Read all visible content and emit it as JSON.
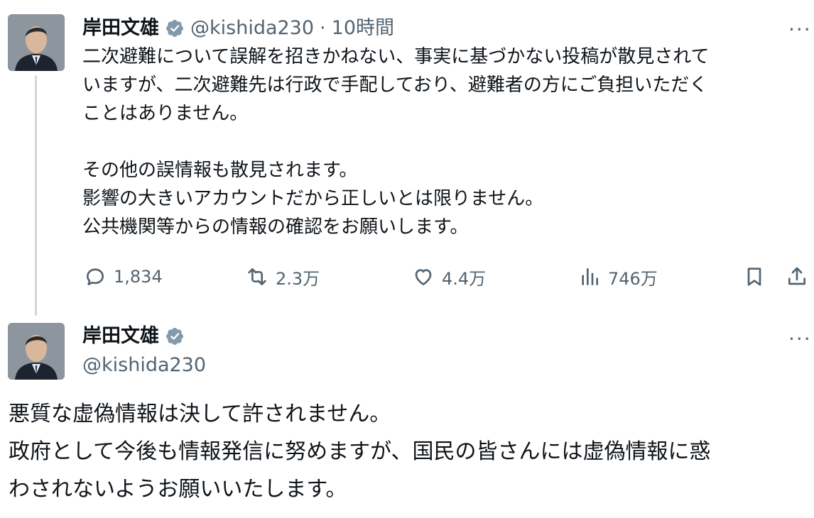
{
  "tweet1": {
    "author_name": "岸田文雄",
    "handle": "@kishida230",
    "separator": "·",
    "time": "10時間",
    "more": "···",
    "paragraphs": [
      [
        "二次避難について誤解を招きかねない、事実に基づかない投稿が散見されて",
        "いますが、二次避難先は行政で手配しており、避難者の方にご負担いただく",
        "ことはありません。"
      ],
      [
        "その他の誤情報も散見されます。",
        "影響の大きいアカウントだから正しいとは限りません。",
        "公共機関等からの情報の確認をお願いします。"
      ]
    ],
    "actions": {
      "reply_count": "1,834",
      "repost_count": "2.3万",
      "like_count": "4.4万",
      "view_count": "746万"
    }
  },
  "tweet2": {
    "author_name": "岸田文雄",
    "handle": "@kishida230",
    "more": "···",
    "lines": [
      "悪質な虚偽情報は決して許されません。",
      "政府として今後も情報発信に努めますが、国民の皆さんには虚偽情報に惑",
      "わされないようお願いいたします。"
    ]
  },
  "colors": {
    "text": "#0f1419",
    "secondary": "#536471",
    "verified_badge": "#829aab",
    "thread_line": "#cfd9de"
  },
  "icons": [
    "verified-badge-icon",
    "more-icon",
    "reply-icon",
    "repost-icon",
    "like-icon",
    "views-icon",
    "bookmark-icon",
    "share-icon"
  ]
}
